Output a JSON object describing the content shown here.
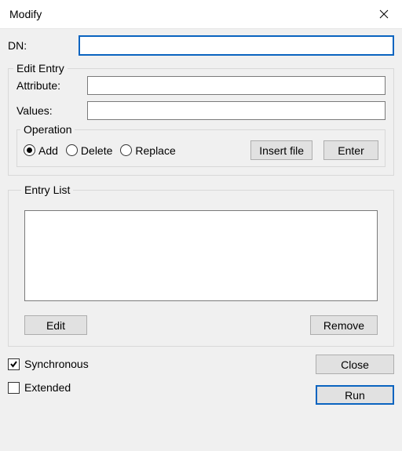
{
  "window": {
    "title": "Modify"
  },
  "dn": {
    "label": "DN:",
    "value": ""
  },
  "edit_entry": {
    "legend": "Edit Entry",
    "attribute_label": "Attribute:",
    "attribute_value": "",
    "values_label": "Values:",
    "values_value": ""
  },
  "operation": {
    "legend": "Operation",
    "options": {
      "add": "Add",
      "delete": "Delete",
      "replace": "Replace"
    },
    "selected": "add",
    "insert_file_label": "Insert file",
    "enter_label": "Enter"
  },
  "entry_list": {
    "legend": "Entry List",
    "items": [],
    "edit_label": "Edit",
    "remove_label": "Remove"
  },
  "checks": {
    "synchronous": {
      "label": "Synchronous",
      "checked": true
    },
    "extended": {
      "label": "Extended",
      "checked": false
    }
  },
  "buttons": {
    "close": "Close",
    "run": "Run"
  }
}
